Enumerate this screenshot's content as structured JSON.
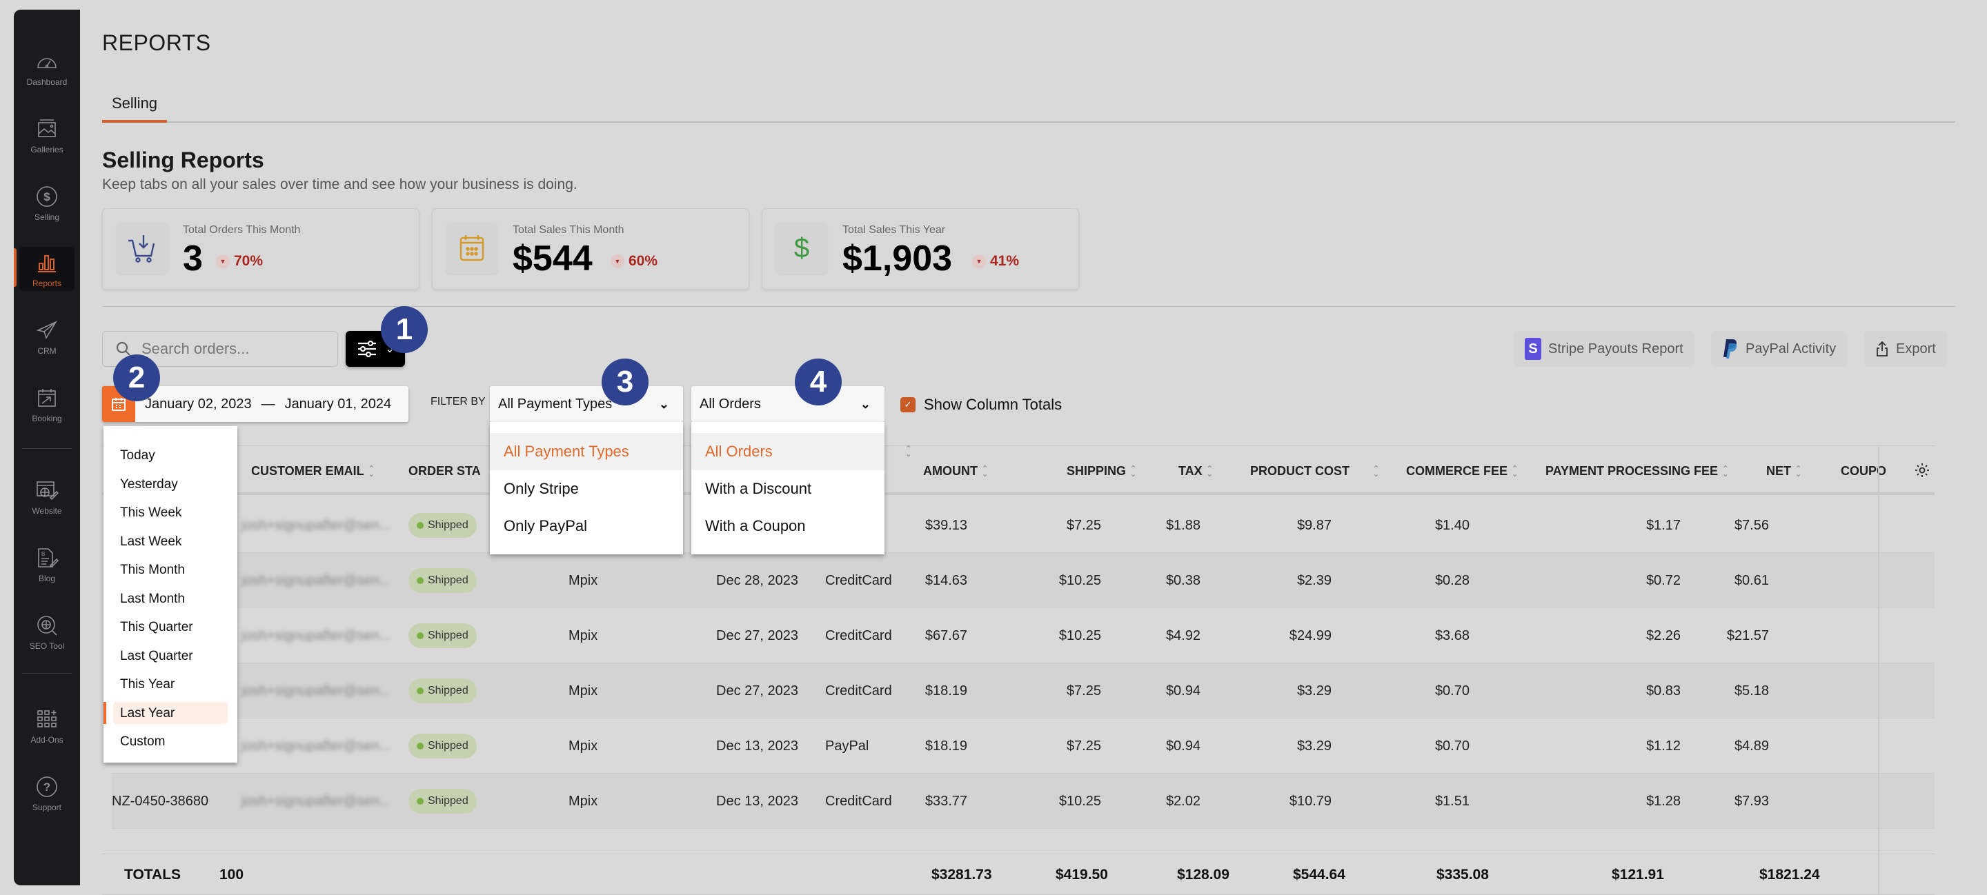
{
  "sidebar": {
    "items": [
      {
        "label": "Dashboard",
        "icon": "dashboard-gauge-icon"
      },
      {
        "label": "Galleries",
        "icon": "gallery-image-icon"
      },
      {
        "label": "Selling",
        "icon": "dollar-circle-icon"
      },
      {
        "label": "Reports",
        "icon": "bar-chart-icon",
        "active": true
      },
      {
        "label": "CRM",
        "icon": "paper-plane-icon"
      },
      {
        "label": "Booking",
        "icon": "calendar-booking-icon"
      },
      {
        "label": "Website",
        "icon": "website-globe-icon"
      },
      {
        "label": "Blog",
        "icon": "blog-document-icon"
      },
      {
        "label": "SEO Tool",
        "icon": "seo-globe-search-icon"
      },
      {
        "label": "Add-Ons",
        "icon": "add-ons-grid-icon"
      },
      {
        "label": "Support",
        "icon": "question-circle-icon"
      }
    ]
  },
  "header": {
    "title": "REPORTS"
  },
  "tabs": [
    {
      "label": "Selling",
      "active": true
    }
  ],
  "section": {
    "title": "Selling Reports",
    "subtitle": "Keep tabs on all your sales over time and see how your business is doing."
  },
  "stats": [
    {
      "label": "Total Orders This Month",
      "value": "3",
      "delta": "70%",
      "direction": "down",
      "icon": "cart-download-icon",
      "icon_color": "#3a4a8a"
    },
    {
      "label": "Total Sales This Month",
      "value": "$544",
      "delta": "60%",
      "direction": "down",
      "icon": "calendar-icon",
      "icon_color": "#d49a2a"
    },
    {
      "label": "Total Sales This Year",
      "value": "$1,903",
      "delta": "41%",
      "direction": "down",
      "icon": "dollar-icon",
      "icon_color": "#3f9a3f"
    }
  ],
  "toolbar": {
    "search_placeholder": "Search orders...",
    "stripe_button": "Stripe Payouts Report",
    "stripe_logo_letter": "S",
    "paypal_button": "PayPal Activity",
    "export_button": "Export"
  },
  "filters": {
    "date_start": "January 02, 2023",
    "date_sep": "—",
    "date_end": "January 01, 2024",
    "filter_by_label": "FILTER BY",
    "payment_type": {
      "selected": "All Payment Types",
      "options": [
        "All Payment Types",
        "Only Stripe",
        "Only PayPal"
      ]
    },
    "order_type": {
      "selected": "All Orders",
      "options": [
        "All Orders",
        "With a Discount",
        "With a Coupon"
      ]
    },
    "show_totals_label": "Show Column Totals",
    "show_totals_checked": true,
    "date_presets": [
      "Today",
      "Yesterday",
      "This Week",
      "Last Week",
      "This Month",
      "Last Month",
      "This Quarter",
      "Last Quarter",
      "This Year",
      "Last Year",
      "Custom"
    ],
    "date_preset_selected": "Last Year"
  },
  "table": {
    "columns": [
      "CUSTOMER EMAIL",
      "ORDER STA",
      "AMOUNT",
      "SHIPPING",
      "TAX",
      "PRODUCT COST",
      "COMMERCE FEE",
      "PAYMENT PROCESSING FEE",
      "NET",
      "COUPO"
    ],
    "rows": [
      {
        "order": "",
        "email": "josh+signupafter@sen...",
        "status": "Shipped",
        "lab": "",
        "date": "",
        "method": "",
        "amount": "$39.13",
        "shipping": "$7.25",
        "tax": "$1.88",
        "product_cost": "$9.87",
        "commerce_fee": "$1.40",
        "processing_fee": "$1.17",
        "net": "$7.56"
      },
      {
        "order": "",
        "email": "josh+signupafter@sen...",
        "status": "Shipped",
        "lab": "Mpix",
        "date": "Dec 28, 2023",
        "method": "CreditCard",
        "amount": "$14.63",
        "shipping": "$10.25",
        "tax": "$0.38",
        "product_cost": "$2.39",
        "commerce_fee": "$0.28",
        "processing_fee": "$0.72",
        "net": "$0.61"
      },
      {
        "order": "",
        "email": "josh+signupafter@sen...",
        "status": "Shipped",
        "lab": "Mpix",
        "date": "Dec 27, 2023",
        "method": "CreditCard",
        "amount": "$67.67",
        "shipping": "$10.25",
        "tax": "$4.92",
        "product_cost": "$24.99",
        "commerce_fee": "$3.68",
        "processing_fee": "$2.26",
        "net": "$21.57"
      },
      {
        "order": "",
        "email": "josh+signupafter@sen...",
        "status": "Shipped",
        "lab": "Mpix",
        "date": "Dec 27, 2023",
        "method": "CreditCard",
        "amount": "$18.19",
        "shipping": "$7.25",
        "tax": "$0.94",
        "product_cost": "$3.29",
        "commerce_fee": "$0.70",
        "processing_fee": "$0.83",
        "net": "$5.18"
      },
      {
        "order": "",
        "email": "josh+signupafter@sen...",
        "status": "Shipped",
        "lab": "Mpix",
        "date": "Dec 13, 2023",
        "method": "PayPal",
        "amount": "$18.19",
        "shipping": "$7.25",
        "tax": "$0.94",
        "product_cost": "$3.29",
        "commerce_fee": "$0.70",
        "processing_fee": "$1.12",
        "net": "$4.89"
      },
      {
        "order": "NZ-0450-38680",
        "email": "josh+signupafter@sen...",
        "status": "Shipped",
        "lab": "Mpix",
        "date": "Dec 13, 2023",
        "method": "CreditCard",
        "amount": "$33.77",
        "shipping": "$10.25",
        "tax": "$2.02",
        "product_cost": "$10.79",
        "commerce_fee": "$1.51",
        "processing_fee": "$1.28",
        "net": "$7.93"
      }
    ],
    "totals": {
      "label": "TOTALS",
      "count": "100",
      "amount": "$3281.73",
      "shipping": "$419.50",
      "tax": "$128.09",
      "product_cost": "$544.64",
      "commerce_fee": "$335.08",
      "processing_fee": "$121.91",
      "net": "$1821.24"
    }
  },
  "callouts": [
    "1",
    "2",
    "3",
    "4"
  ],
  "colors": {
    "accent": "#d2612a",
    "callout": "#2f4390",
    "sidebar_bg": "#1b1b1e",
    "negative": "#a8261e"
  }
}
